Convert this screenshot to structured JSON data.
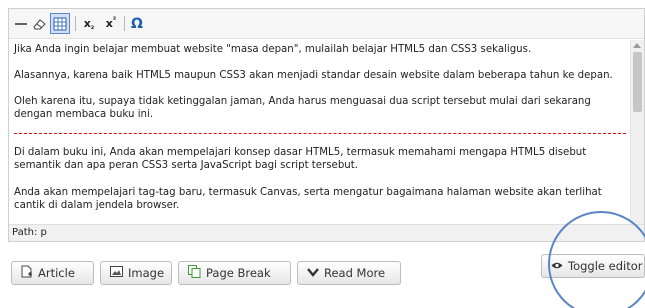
{
  "toolbar": {
    "buttons": [
      {
        "name": "horizontal-rule-icon",
        "glyph": "—"
      },
      {
        "name": "remove-format-icon",
        "glyph": "eraser"
      },
      {
        "name": "visual-aids-icon",
        "glyph": "grid"
      },
      {
        "name": "subscript-icon",
        "label": "x",
        "sub": "₂"
      },
      {
        "name": "superscript-icon",
        "label": "x",
        "sup": "²"
      },
      {
        "name": "special-character-icon",
        "label": "Ω"
      }
    ]
  },
  "content": {
    "paragraphs": [
      "Jika Anda ingin belajar membuat website \"masa depan\", mulailah belajar HTML5 dan CSS3 sekaligus.",
      "Alasannya, karena baik HTML5 maupun CSS3 akan menjadi standar desain website dalam beberapa tahun ke depan.",
      "Oleh karena itu, supaya tidak ketinggalan jaman, Anda harus menguasai dua script tersebut mulai dari sekarang dengan membaca buku ini.",
      "Di dalam buku ini, Anda akan mempelajari konsep dasar HTML5, termasuk memahami mengapa HTML5 disebut semantik dan apa peran CSS3 serta JavaScript bagi script tersebut.",
      "Anda akan mempelajari tag-tag baru, termasuk Canvas, serta mengatur bagaimana halaman website akan terlihat cantik di dalam jendela browser."
    ]
  },
  "statusbar": {
    "path": "Path: p"
  },
  "buttons": {
    "article": "Article",
    "image": "Image",
    "page_break": "Page Break",
    "read_more": "Read More",
    "toggle_editor": "Toggle editor"
  },
  "colors": {
    "pagebreak_line": "#dd1111",
    "highlight_circle": "#5a86c4",
    "icon_blue": "#1e5eb0",
    "page_break_icon": "#3a9a3a"
  }
}
